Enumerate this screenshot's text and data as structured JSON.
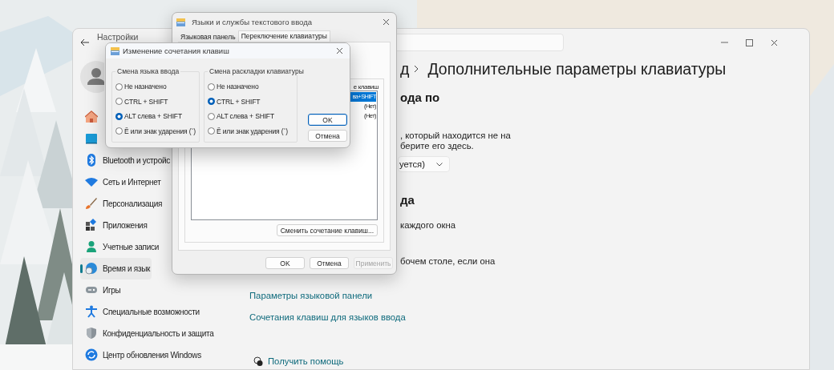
{
  "settings_window": {
    "title": "Настройки",
    "sidebar": {
      "items": [
        {
          "selected": false
        },
        {
          "selected": false
        },
        {
          "label": "Bluetooth и устройс",
          "selected": false
        },
        {
          "label": "Сеть и Интернет",
          "selected": false
        },
        {
          "label": "Персонализация",
          "selected": false
        },
        {
          "label": "Приложения",
          "selected": false
        },
        {
          "label": "Учетные записи",
          "selected": false
        },
        {
          "label": "Время и язык",
          "selected": true
        },
        {
          "label": "Игры",
          "selected": false
        },
        {
          "label": "Специальные возможности",
          "selected": false
        },
        {
          "label": "Конфиденциальность и защита",
          "selected": false
        },
        {
          "label": "Центр обновления Windows",
          "selected": false
        }
      ]
    },
    "main": {
      "breadcrumb_parent": "д",
      "title": "Дополнительные параметры клавиатуры",
      "section_1_heading": "ода по",
      "section_1_text": [
        ", который находится не на",
        "берите его здесь."
      ],
      "dropdown_value": "уется)",
      "section_2_heading": "да",
      "option_1": "каждого окна",
      "option_2": "бочем столе, если она",
      "links": [
        "Параметры языковой панели",
        "Сочетания клавиш для языков ввода"
      ],
      "help_link": "Получить помощь"
    }
  },
  "text_services_dialog": {
    "title": "Языки и службы текстового ввода",
    "tabs": [
      {
        "label": "Языковая панель",
        "selected": false
      },
      {
        "label": "Переключение клавиатуры",
        "selected": true
      }
    ],
    "list_header": "е клавиш",
    "list_rows": [
      {
        "text": "ва+SHIFT",
        "selected": true
      },
      {
        "text": "(Нет)",
        "selected": false
      },
      {
        "text": "(Нет)",
        "selected": false
      }
    ],
    "change_button": "Сменить сочетание клавиш...",
    "buttons": [
      {
        "label": "OK",
        "disabled": false
      },
      {
        "label": "Отмена",
        "disabled": false
      },
      {
        "label": "Применить",
        "disabled": true
      }
    ]
  },
  "hotkey_dialog": {
    "title": "Изменение сочетания клавиш",
    "groups": [
      {
        "label": "Смена языка ввода",
        "options": [
          {
            "label": "Не назначено",
            "selected": false
          },
          {
            "label": "CTRL + SHIFT",
            "selected": false
          },
          {
            "label": "ALT слева + SHIFT",
            "selected": true
          },
          {
            "label": "Ё или знак ударения (`)",
            "selected": false
          }
        ]
      },
      {
        "label": "Смена раскладки клавиатуры",
        "options": [
          {
            "label": "Не назначено",
            "selected": false
          },
          {
            "label": "CTRL + SHIFT",
            "selected": true
          },
          {
            "label": "ALT слева + SHIFT",
            "selected": false
          },
          {
            "label": "Ё или знак ударения (`)",
            "selected": false
          }
        ]
      }
    ],
    "buttons": [
      {
        "label": "OK",
        "default": true
      },
      {
        "label": "Отмена",
        "default": false
      }
    ]
  }
}
